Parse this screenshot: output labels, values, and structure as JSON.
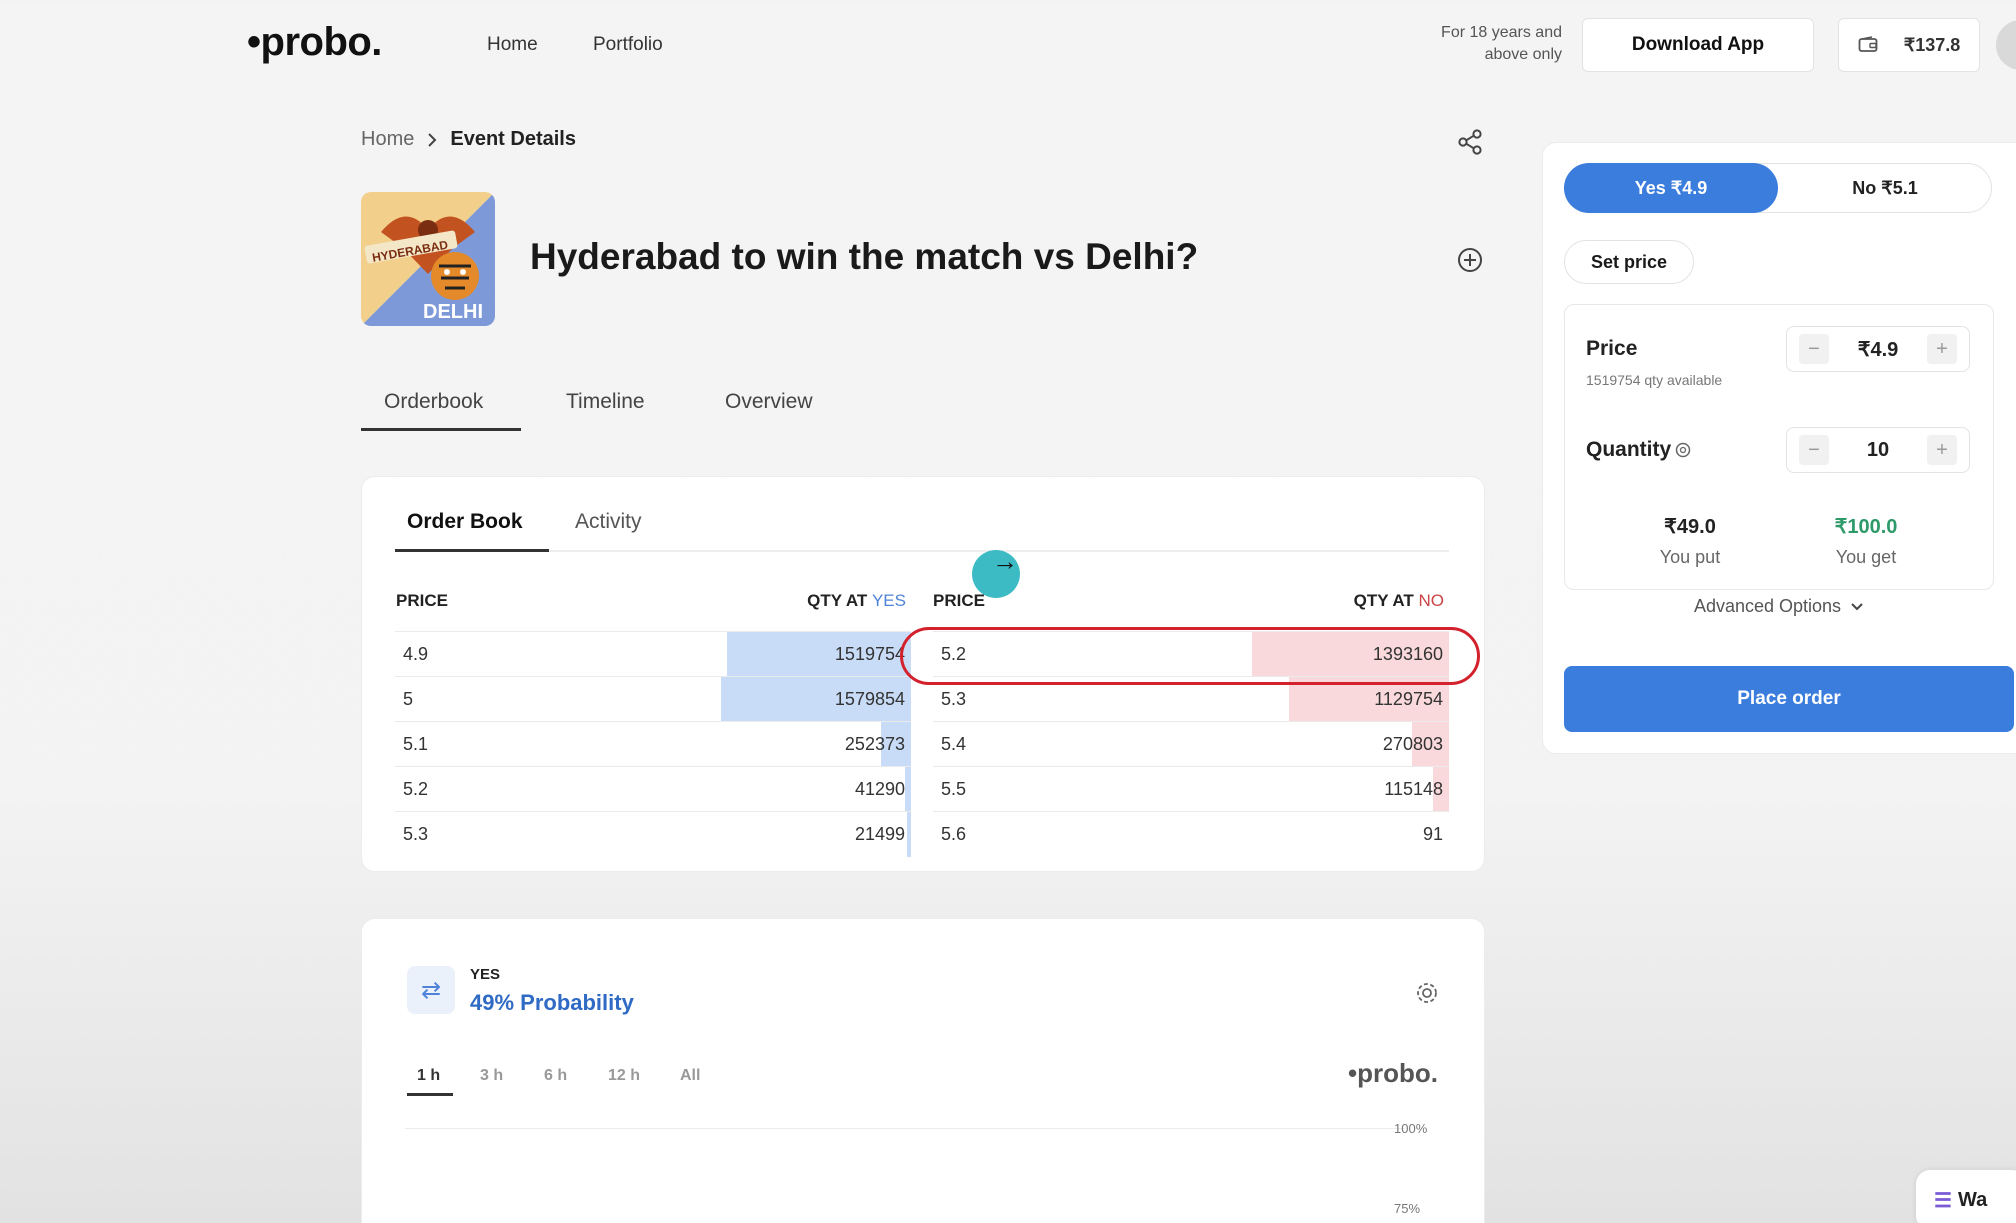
{
  "header": {
    "logo": "•probo.",
    "nav": [
      "Home",
      "Portfolio"
    ],
    "age_note": "For 18 years and above only",
    "download_label": "Download App",
    "wallet_balance": "₹137.8"
  },
  "breadcrumb": {
    "home": "Home",
    "current": "Event Details"
  },
  "event": {
    "title": "Hyderabad to win the match vs Delhi?",
    "image_text_top": "HYDERABAD",
    "image_text_bottom": "DELHI"
  },
  "main_tabs": [
    "Orderbook",
    "Timeline",
    "Overview"
  ],
  "orderbook": {
    "tabs": [
      "Order Book",
      "Activity"
    ],
    "headers": {
      "price": "PRICE",
      "qty_at": "QTY AT",
      "yes": "YES",
      "no": "NO"
    },
    "yes_rows": [
      {
        "price": "4.9",
        "qty": "1519754",
        "fill": 0.97
      },
      {
        "price": "5",
        "qty": "1579854",
        "fill": 1.0
      },
      {
        "price": "5.1",
        "qty": "252373",
        "fill": 0.16
      },
      {
        "price": "5.2",
        "qty": "41290",
        "fill": 0.03
      },
      {
        "price": "5.3",
        "qty": "21499",
        "fill": 0.01
      }
    ],
    "no_rows": [
      {
        "price": "5.2",
        "qty": "1393160",
        "fill": 1.0
      },
      {
        "price": "5.3",
        "qty": "1129754",
        "fill": 0.81
      },
      {
        "price": "5.4",
        "qty": "270803",
        "fill": 0.19
      },
      {
        "price": "5.5",
        "qty": "115148",
        "fill": 0.08
      },
      {
        "price": "5.6",
        "qty": "91",
        "fill": 0.0
      }
    ]
  },
  "probability": {
    "side": "YES",
    "value": "49% Probability",
    "ranges": [
      "1 h",
      "3 h",
      "6 h",
      "12 h",
      "All"
    ],
    "watermark": "•probo.",
    "axis_labels": [
      "100%",
      "75%"
    ]
  },
  "order_panel": {
    "yes_label": "Yes ₹4.9",
    "no_label": "No ₹5.1",
    "set_price": "Set price",
    "price_label": "Price",
    "price_value": "₹4.9",
    "qty_available": "1519754 qty available",
    "quantity_label": "Quantity",
    "quantity_value": "10",
    "you_put_value": "₹49.0",
    "you_put_label": "You put",
    "you_get_value": "₹100.0",
    "you_get_label": "You get",
    "advanced": "Advanced Options",
    "place_order": "Place order"
  },
  "whatsapp_chip": "Wa",
  "colors": {
    "accent": "#3b7ddd",
    "yes_bar": "#c8dcf8",
    "no_bar": "#f9d9db",
    "highlight": "#d3212d",
    "profit": "#2e9a6a"
  }
}
